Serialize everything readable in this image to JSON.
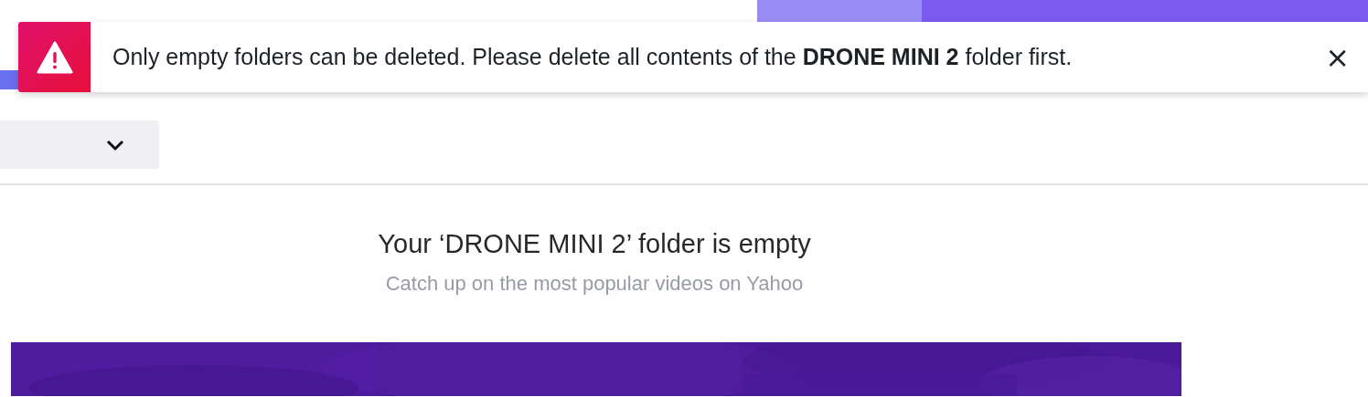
{
  "toast": {
    "kind": "error",
    "message": "Only empty folders can be deleted. Please delete all contents of the **DRONE MINI 2** folder first.",
    "close": "×"
  },
  "empty_state": {
    "title": "Your ‘DRONE MINI 2’ folder is empty",
    "subtitle": "Catch up on the most popular videos on Yahoo"
  }
}
